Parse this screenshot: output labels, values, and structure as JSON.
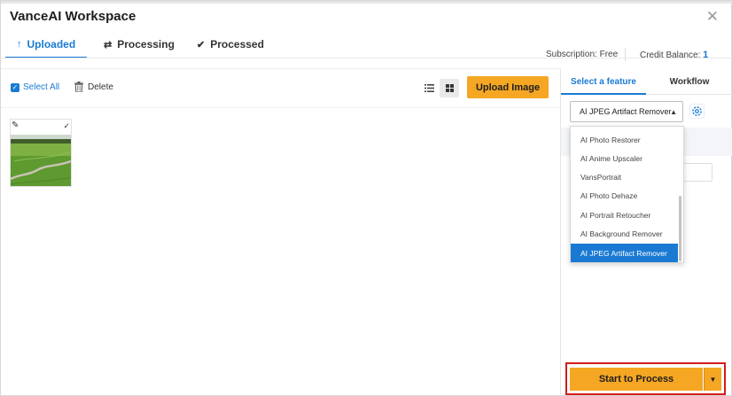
{
  "window": {
    "title": "VanceAI Workspace",
    "close_icon": "close-icon"
  },
  "tabs": [
    {
      "label": "Uploaded",
      "icon": "upload-arrow-icon",
      "glyph": "↑"
    },
    {
      "label": "Processing",
      "icon": "refresh-icon",
      "glyph": "⇄"
    },
    {
      "label": "Processed",
      "icon": "check-circle-icon",
      "glyph": "✔"
    }
  ],
  "account": {
    "subscription_label": "Subscription:",
    "subscription_value": "Free",
    "credit_label": "Credit Balance:",
    "credit_value": "1"
  },
  "toolbar": {
    "select_all": "Select All",
    "delete": "Delete",
    "upload_button": "Upload Image"
  },
  "right_panel": {
    "tabs": [
      "Select a feature",
      "Workflow"
    ],
    "selected_feature": "AI JPEG Artifact Remover",
    "dropdown_options": [
      "AI Photo Restorer",
      "AI Anime Upscaler",
      "VansPortrait",
      "AI Photo Dehaze",
      "AI Portrait Retoucher",
      "AI Background Remover",
      "AI JPEG Artifact Remover"
    ],
    "selected_index": 6,
    "start_button": "Start to Process"
  },
  "colors": {
    "accent": "#1a7ad3",
    "button": "#f5a623",
    "highlight_border": "#d41c1c"
  }
}
